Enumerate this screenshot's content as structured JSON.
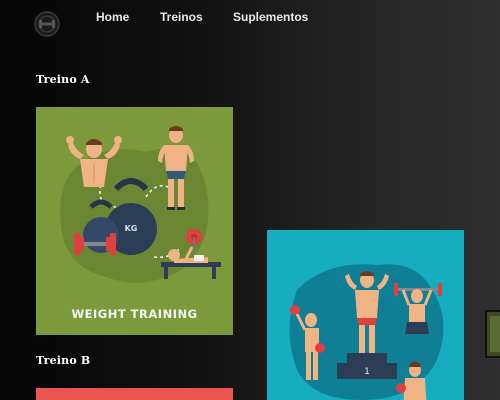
{
  "nav": {
    "logo_icon": "gym-logo-icon",
    "items": [
      {
        "label": "Home"
      },
      {
        "label": "Treinos"
      },
      {
        "label": "Suplementos"
      }
    ]
  },
  "sections": {
    "treino_a": {
      "title": "Treino A",
      "card_caption": "WEIGHT TRAINING",
      "kettlebell_label": "KG"
    },
    "treino_b": {
      "title": "Treino B"
    },
    "podium_card": {
      "podium_number": "1"
    }
  },
  "colors": {
    "card_a_bg": "#7c9a3c",
    "card_b_bg": "#e9554f",
    "card_c_bg": "#16aebf"
  }
}
